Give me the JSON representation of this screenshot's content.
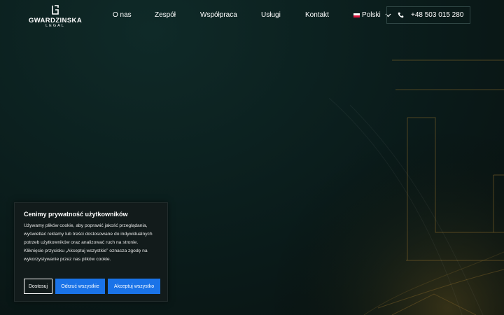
{
  "brand": {
    "name": "GWARDZINSKA",
    "sub": "LEGAL"
  },
  "nav": {
    "items": [
      {
        "label": "O nas"
      },
      {
        "label": "Zespół"
      },
      {
        "label": "Współpraca"
      },
      {
        "label": "Usługi"
      },
      {
        "label": "Kontakt"
      }
    ],
    "language": "Polski",
    "phone": "+48 503 015 280"
  },
  "cookie": {
    "title": "Cenimy prywatność użytkowników",
    "text": "Używamy plików cookie, aby poprawić jakość przeglądania, wyświetlać reklamy lub treści dostosowane do indywidualnych potrzeb użytkowników oraz analizować ruch na stronie. Kliknięcie przycisku „Akceptuj wszystkie” oznacza zgodę na wykorzystywanie przez nas plików cookie.",
    "customize": "Dostosuj",
    "reject": "Odrzuć wszystkie",
    "accept": "Akceptuj wszystko"
  },
  "colors": {
    "accent_blue": "#1a73e8",
    "gold_line": "#8a6a2a",
    "background": "#0b1e1d"
  },
  "icons": {
    "logo": "g-monogram-icon",
    "flag": "poland-flag-icon",
    "chevron": "chevron-down-icon",
    "phone": "phone-icon"
  }
}
